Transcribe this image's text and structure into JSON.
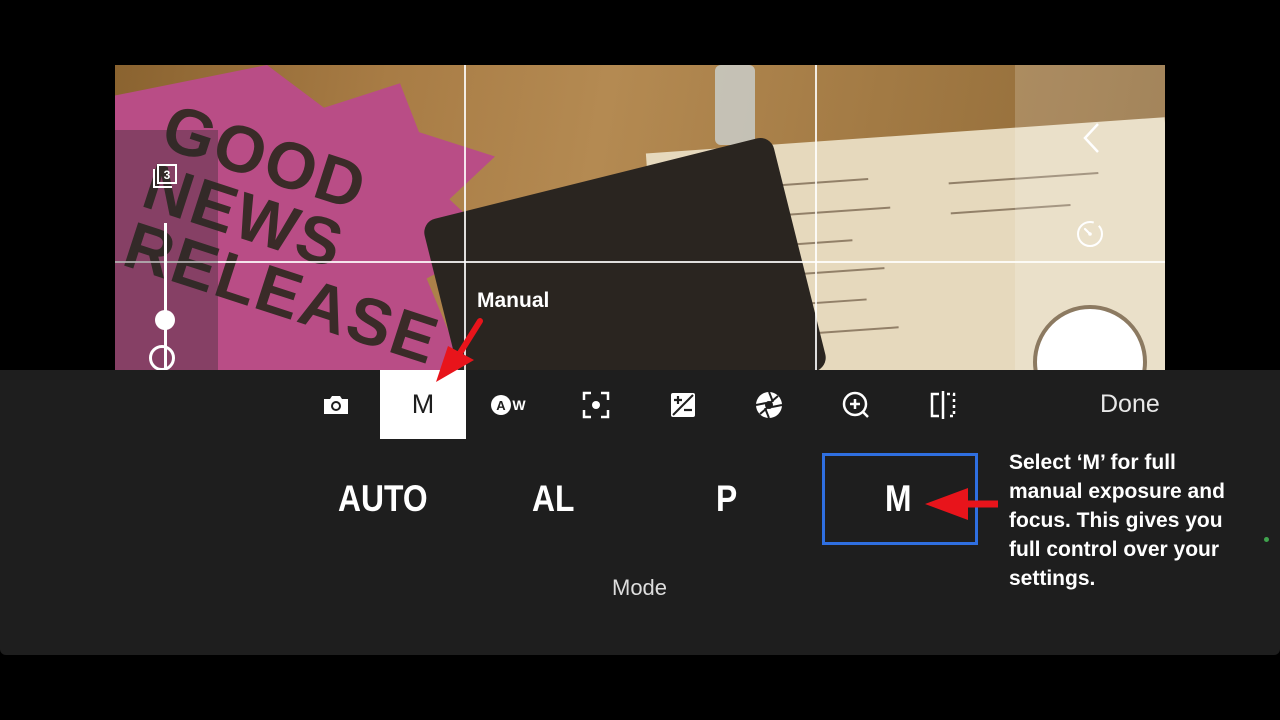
{
  "viewfinder": {
    "poster_text": "GOOD NEWS RELEASE"
  },
  "toolbar": {
    "items": [
      {
        "name": "camera",
        "label": ""
      },
      {
        "name": "manual",
        "label": "M"
      },
      {
        "name": "white-balance",
        "label": "AW"
      },
      {
        "name": "focus",
        "label": ""
      },
      {
        "name": "exposure-compensation",
        "label": ""
      },
      {
        "name": "aperture",
        "label": ""
      },
      {
        "name": "zoom-add",
        "label": ""
      },
      {
        "name": "compare",
        "label": ""
      }
    ],
    "done_label": "Done",
    "layers_count": "3"
  },
  "mode": {
    "options": [
      "AUTO",
      "AL",
      "P",
      "M"
    ],
    "selected": "M",
    "label": "Mode"
  },
  "annotations": {
    "manual_callout": "Manual",
    "note": "Select ‘M’ for full manual exposure and focus. This gives you full control over your settings.",
    "arrow_color": "#e8141b",
    "highlight_color": "#2f6fe0"
  }
}
